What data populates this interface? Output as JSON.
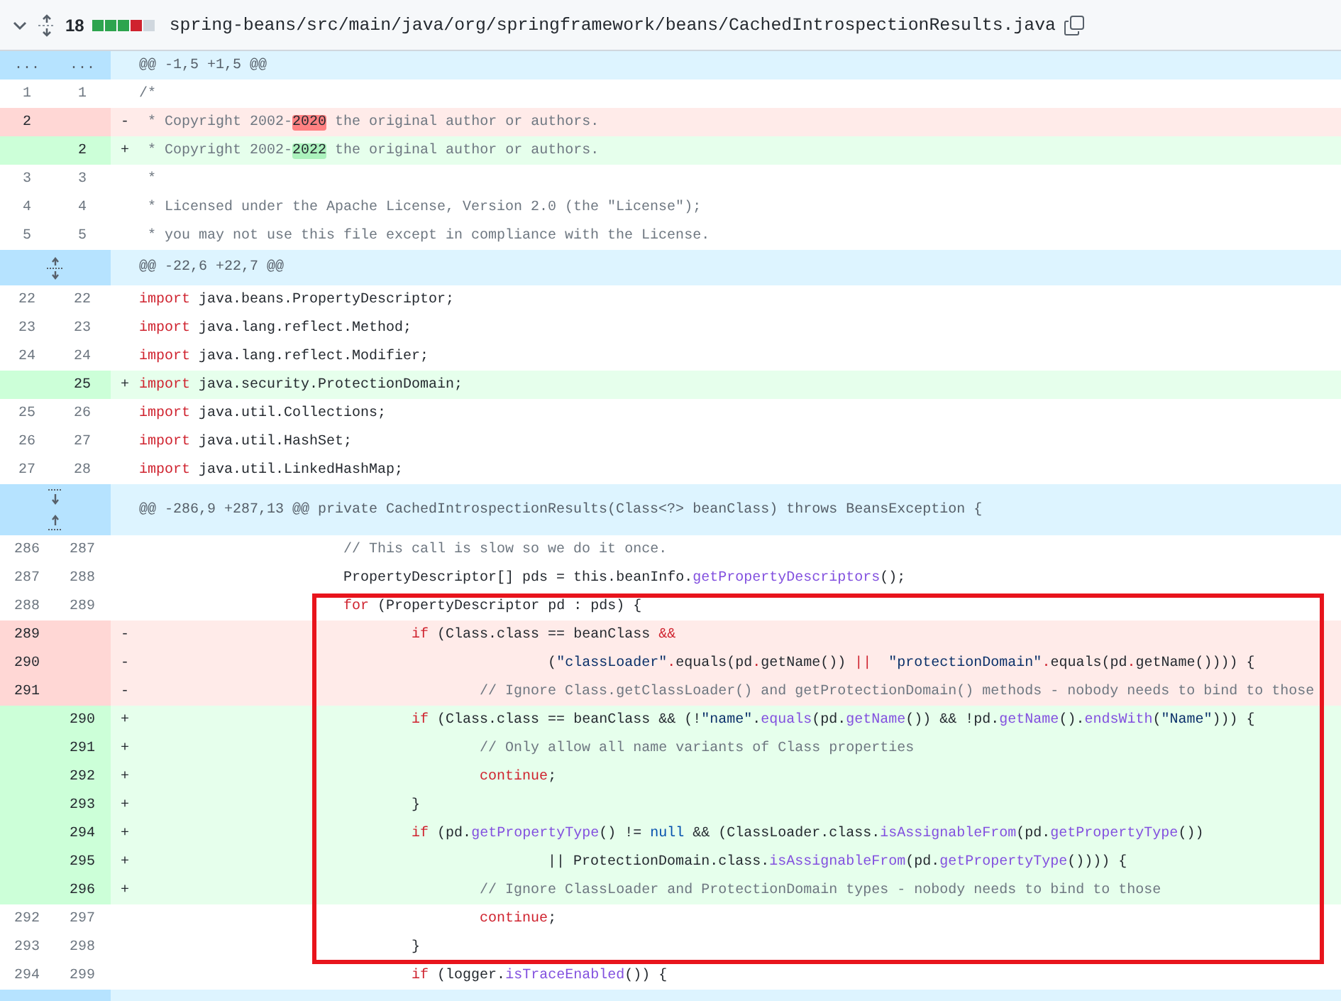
{
  "file_header": {
    "changes": "18",
    "diffstat": [
      {
        "color": "#2da44e"
      },
      {
        "color": "#2da44e"
      },
      {
        "color": "#2da44e"
      },
      {
        "color": "#cf222e"
      },
      {
        "color": "#d0d7de"
      }
    ],
    "path": "spring-beans/src/main/java/org/springframework/beans/CachedIntrospectionResults.java"
  },
  "rows": [
    {
      "kind": "hunk",
      "old": "...",
      "new": "...",
      "header": "@@ -1,5 +1,5 @@"
    },
    {
      "kind": "context",
      "old": "1",
      "new": "1",
      "code": [
        {
          "text": "/*",
          "kind": "comment"
        }
      ]
    },
    {
      "kind": "deleted",
      "old": "2",
      "marker": "-",
      "code": [
        {
          "text": " * Copyright 2002-",
          "kind": "comment"
        },
        {
          "text": "2020",
          "kind": "removed-word"
        },
        {
          "text": " the original author or authors.",
          "kind": "comment"
        }
      ]
    },
    {
      "kind": "added",
      "new": "2",
      "marker": "+",
      "code": [
        {
          "text": " * Copyright 2002-",
          "kind": "comment"
        },
        {
          "text": "2022",
          "kind": "added-word"
        },
        {
          "text": " the original author or authors.",
          "kind": "comment"
        }
      ]
    },
    {
      "kind": "context",
      "old": "3",
      "new": "3",
      "code": [
        {
          "text": " *",
          "kind": "comment"
        }
      ]
    },
    {
      "kind": "context",
      "old": "4",
      "new": "4",
      "code": [
        {
          "text": " * Licensed under the Apache License, Version 2.0 (the \"License\");",
          "kind": "comment"
        }
      ]
    },
    {
      "kind": "context",
      "old": "5",
      "new": "5",
      "code": [
        {
          "text": " * you may not use this file except in compliance with the License.",
          "kind": "comment"
        }
      ]
    },
    {
      "kind": "expandable",
      "header": "@@ -22,6 +22,7 @@"
    },
    {
      "kind": "context",
      "old": "22",
      "new": "22",
      "code": [
        {
          "text": "import",
          "kind": "keyword"
        },
        {
          "text": " java.beans.PropertyDescriptor;",
          "kind": "plain"
        }
      ]
    },
    {
      "kind": "context",
      "old": "23",
      "new": "23",
      "code": [
        {
          "text": "import",
          "kind": "keyword"
        },
        {
          "text": " java.lang.reflect.Method;",
          "kind": "plain"
        }
      ]
    },
    {
      "kind": "context",
      "old": "24",
      "new": "24",
      "code": [
        {
          "text": "import",
          "kind": "keyword"
        },
        {
          "text": " java.lang.reflect.Modifier;",
          "kind": "plain"
        }
      ]
    },
    {
      "kind": "added",
      "new": "25",
      "marker": "+",
      "code": [
        {
          "text": "import",
          "kind": "keyword"
        },
        {
          "text": " java.security.ProtectionDomain;",
          "kind": "plain"
        }
      ]
    },
    {
      "kind": "context",
      "old": "25",
      "new": "26",
      "code": [
        {
          "text": "import",
          "kind": "keyword"
        },
        {
          "text": " java.util.Collections;",
          "kind": "plain"
        }
      ]
    },
    {
      "kind": "context",
      "old": "26",
      "new": "27",
      "code": [
        {
          "text": "import",
          "kind": "keyword"
        },
        {
          "text": " java.util.HashSet;",
          "kind": "plain"
        }
      ]
    },
    {
      "kind": "context",
      "old": "27",
      "new": "28",
      "code": [
        {
          "text": "import",
          "kind": "keyword"
        },
        {
          "text": " java.util.LinkedHashMap;",
          "kind": "plain"
        }
      ]
    },
    {
      "kind": "expandboth",
      "header": "@@ -286,9 +287,13 @@ private CachedIntrospectionResults(Class<?> beanClass) throws BeansException {"
    },
    {
      "kind": "context",
      "old": "286",
      "new": "287",
      "code": [
        {
          "text": "\t\t\t// This call is slow so we do it once.",
          "kind": "comment"
        }
      ]
    },
    {
      "kind": "context",
      "old": "287",
      "new": "288",
      "code": [
        {
          "text": "\t\t\tPropertyDescriptor[] pds = this.beanInfo.",
          "kind": "plain"
        },
        {
          "text": "getPropertyDescriptors",
          "kind": "method"
        },
        {
          "text": "();",
          "kind": "plain"
        }
      ]
    },
    {
      "kind": "context",
      "old": "288",
      "new": "289",
      "code": [
        {
          "text": "\t\t\tfor",
          "kind": "keyword"
        },
        {
          "text": " (PropertyDescriptor pd : pds) {",
          "kind": "plain"
        }
      ]
    },
    {
      "kind": "deleted",
      "old": "289",
      "marker": "-",
      "code": [
        {
          "text": "\t\t\t\tif",
          "kind": "keyword"
        },
        {
          "text": " (Class.class == beanClass ",
          "kind": "plain"
        },
        {
          "text": "&&",
          "kind": "keyword"
        }
      ]
    },
    {
      "kind": "deleted",
      "old": "290",
      "marker": "-",
      "code": [
        {
          "text": "\t\t\t\t\t\t(",
          "kind": "plain"
        },
        {
          "text": "\"classLoader\"",
          "kind": "string"
        },
        {
          "text": ".",
          "kind": "keyword"
        },
        {
          "text": "equals(pd",
          "kind": "plain"
        },
        {
          "text": ".",
          "kind": "keyword"
        },
        {
          "text": "getName()) ",
          "kind": "plain"
        },
        {
          "text": "||  ",
          "kind": "keyword"
        },
        {
          "text": "\"protectionDomain\"",
          "kind": "string"
        },
        {
          "text": ".",
          "kind": "keyword"
        },
        {
          "text": "equals(pd",
          "kind": "plain"
        },
        {
          "text": ".",
          "kind": "keyword"
        },
        {
          "text": "getName()))) {",
          "kind": "plain"
        }
      ]
    },
    {
      "kind": "deleted",
      "old": "291",
      "marker": "-",
      "code": [
        {
          "text": "\t\t\t\t\t// Ignore Class.getClassLoader() and getProtectionDomain() methods - nobody needs to bind to those",
          "kind": "comment"
        }
      ]
    },
    {
      "kind": "added",
      "new": "290",
      "marker": "+",
      "code": [
        {
          "text": "\t\t\t\tif",
          "kind": "keyword"
        },
        {
          "text": " (Class.class == beanClass && (!",
          "kind": "plain"
        },
        {
          "text": "\"name\"",
          "kind": "string"
        },
        {
          "text": ".",
          "kind": "plain"
        },
        {
          "text": "equals",
          "kind": "method"
        },
        {
          "text": "(pd.",
          "kind": "plain"
        },
        {
          "text": "getName",
          "kind": "method"
        },
        {
          "text": "()) && !pd.",
          "kind": "plain"
        },
        {
          "text": "getName",
          "kind": "method"
        },
        {
          "text": "().",
          "kind": "plain"
        },
        {
          "text": "endsWith",
          "kind": "method"
        },
        {
          "text": "(",
          "kind": "plain"
        },
        {
          "text": "\"Name\"",
          "kind": "string"
        },
        {
          "text": "))) {",
          "kind": "plain"
        }
      ]
    },
    {
      "kind": "added",
      "new": "291",
      "marker": "+",
      "code": [
        {
          "text": "\t\t\t\t\t// Only allow all name variants of Class properties",
          "kind": "comment"
        }
      ]
    },
    {
      "kind": "added",
      "new": "292",
      "marker": "+",
      "code": [
        {
          "text": "\t\t\t\t\tcontinue",
          "kind": "keyword"
        },
        {
          "text": ";",
          "kind": "plain"
        }
      ]
    },
    {
      "kind": "added",
      "new": "293",
      "marker": "+",
      "code": [
        {
          "text": "\t\t\t\t}",
          "kind": "plain"
        }
      ]
    },
    {
      "kind": "added",
      "new": "294",
      "marker": "+",
      "code": [
        {
          "text": "\t\t\t\tif",
          "kind": "keyword"
        },
        {
          "text": " (pd.",
          "kind": "plain"
        },
        {
          "text": "getPropertyType",
          "kind": "method"
        },
        {
          "text": "() != ",
          "kind": "plain"
        },
        {
          "text": "null",
          "kind": "constant"
        },
        {
          "text": " && (ClassLoader.class.",
          "kind": "plain"
        },
        {
          "text": "isAssignableFrom",
          "kind": "method"
        },
        {
          "text": "(pd.",
          "kind": "plain"
        },
        {
          "text": "getPropertyType",
          "kind": "method"
        },
        {
          "text": "())",
          "kind": "plain"
        }
      ]
    },
    {
      "kind": "added",
      "new": "295",
      "marker": "+",
      "code": [
        {
          "text": "\t\t\t\t\t\t|| ProtectionDomain.class.",
          "kind": "plain"
        },
        {
          "text": "isAssignableFrom",
          "kind": "method"
        },
        {
          "text": "(pd.",
          "kind": "plain"
        },
        {
          "text": "getPropertyType",
          "kind": "method"
        },
        {
          "text": "()))) {",
          "kind": "plain"
        }
      ]
    },
    {
      "kind": "added",
      "new": "296",
      "marker": "+",
      "code": [
        {
          "text": "\t\t\t\t\t// Ignore ClassLoader and ProtectionDomain types - nobody needs to bind to those",
          "kind": "comment"
        }
      ]
    },
    {
      "kind": "context",
      "old": "292",
      "new": "297",
      "code": [
        {
          "text": "\t\t\t\t\tcontinue",
          "kind": "keyword"
        },
        {
          "text": ";",
          "kind": "plain"
        }
      ]
    },
    {
      "kind": "context",
      "old": "293",
      "new": "298",
      "code": [
        {
          "text": "\t\t\t\t}",
          "kind": "plain"
        }
      ]
    },
    {
      "kind": "context",
      "old": "294",
      "new": "299",
      "code": [
        {
          "text": "\t\t\t\tif",
          "kind": "keyword"
        },
        {
          "text": " (logger.",
          "kind": "plain"
        },
        {
          "text": "isTraceEnabled",
          "kind": "method"
        },
        {
          "text": "()) {",
          "kind": "plain"
        }
      ]
    },
    {
      "kind": "fold"
    }
  ],
  "highlight_frame": {
    "color": "#e8141c"
  }
}
